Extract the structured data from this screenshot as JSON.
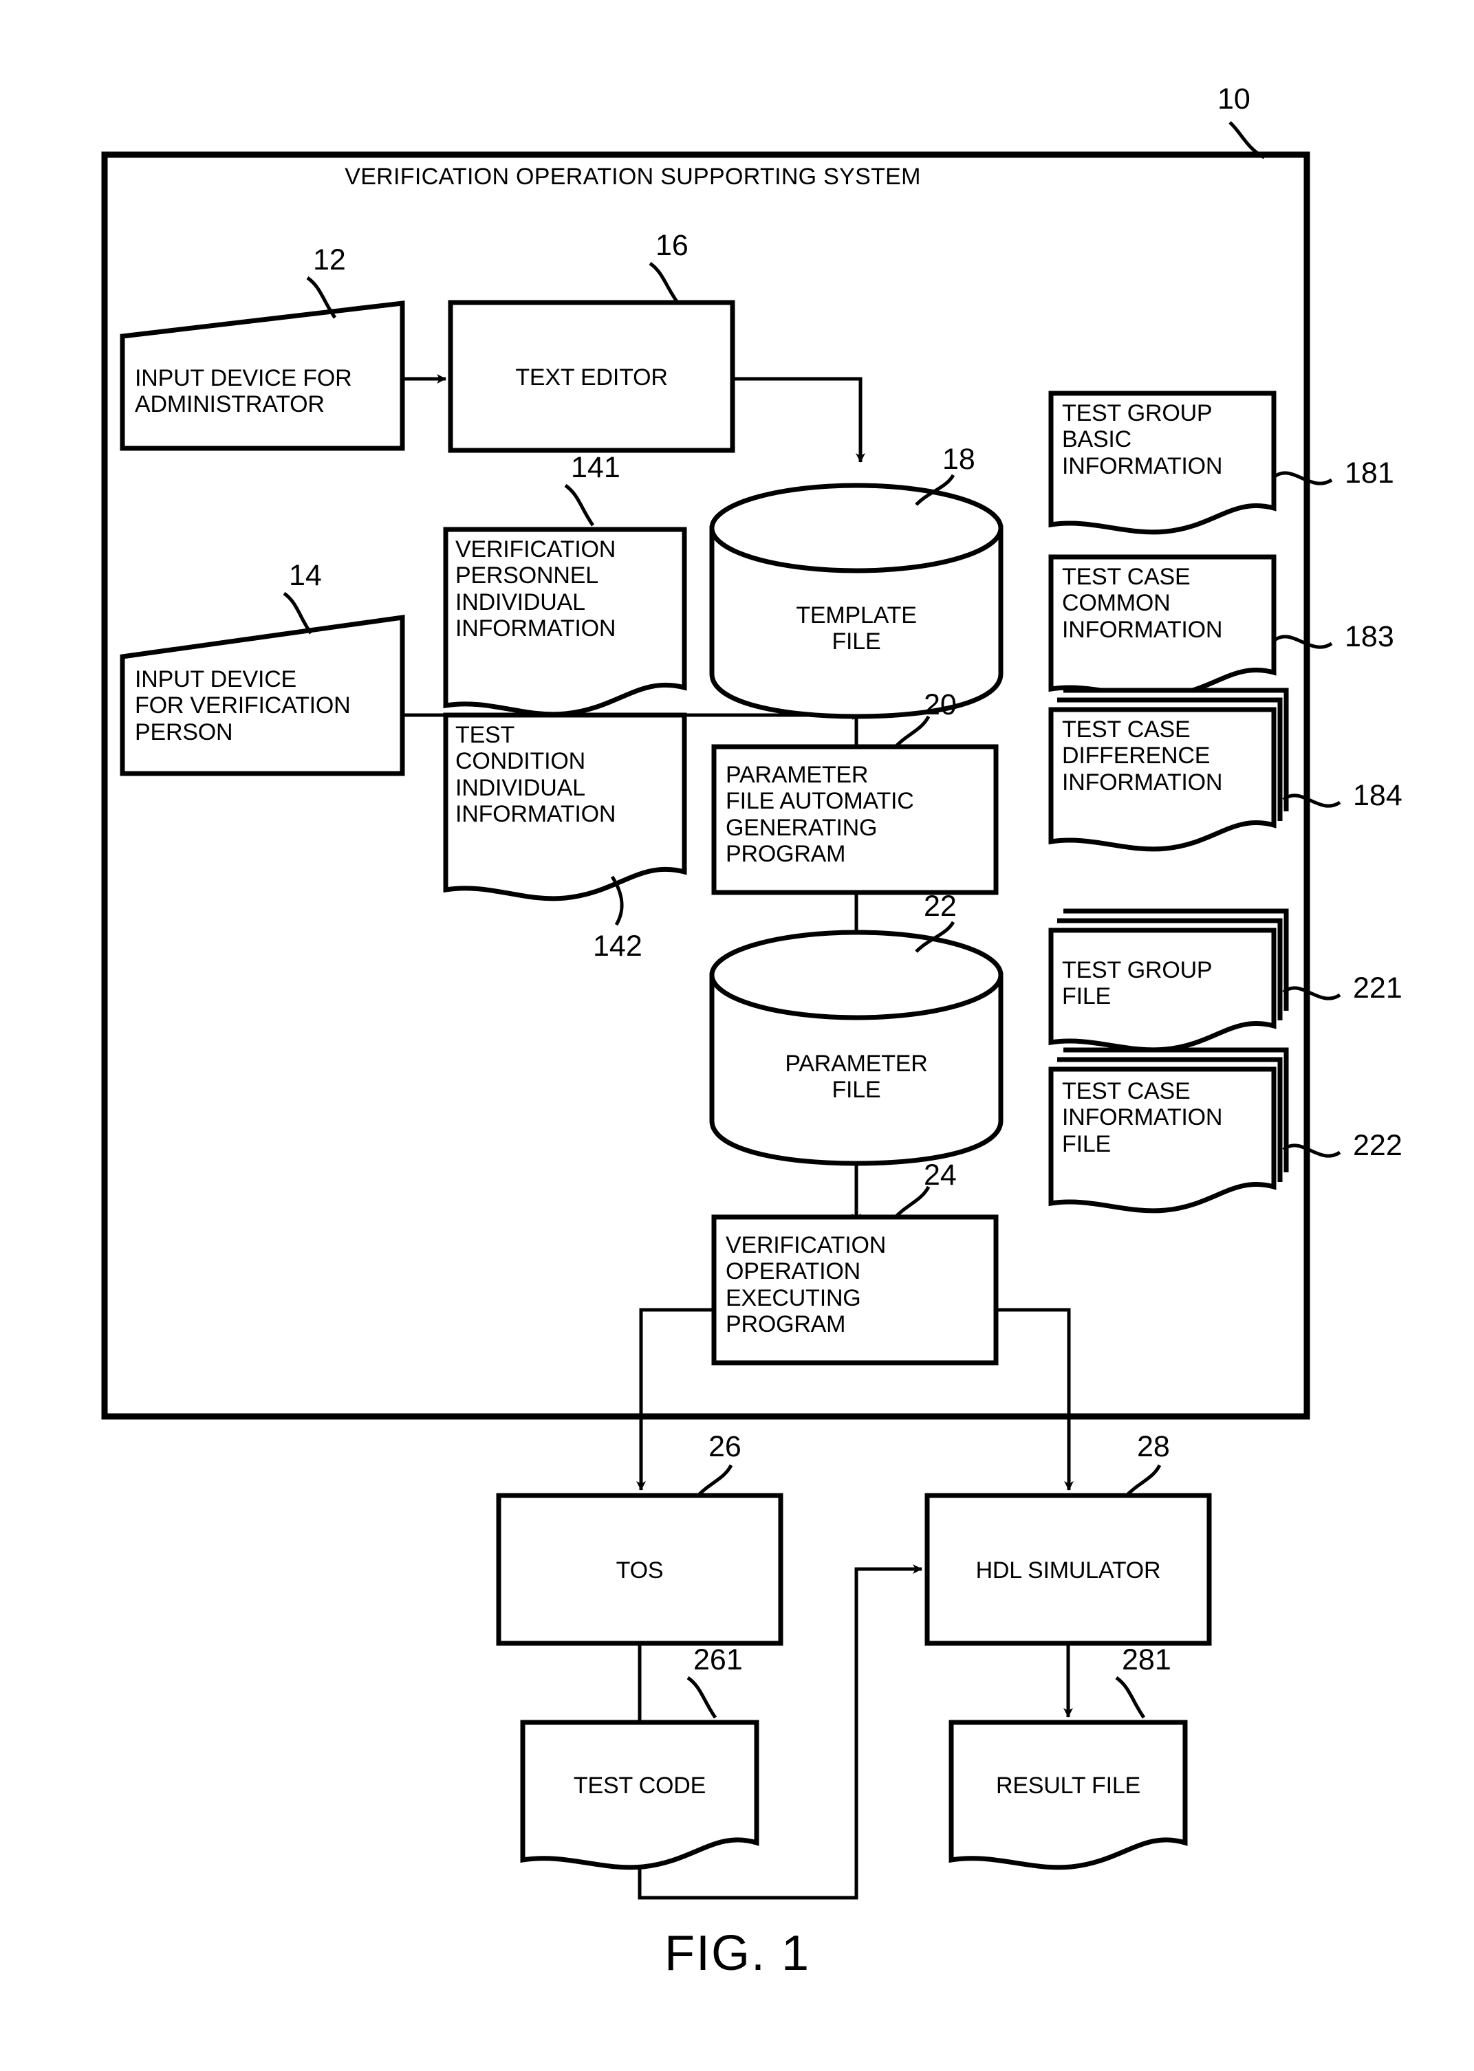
{
  "figure": {
    "caption": "FIG. 1",
    "system_title": "VERIFICATION OPERATION SUPPORTING SYSTEM",
    "system_ref": "10"
  },
  "nodes": {
    "input_device_admin": {
      "label": "INPUT DEVICE FOR\nADMINISTRATOR",
      "ref": "12",
      "shape": "trapezoid"
    },
    "text_editor": {
      "label": "TEXT EDITOR",
      "ref": "16",
      "shape": "rect"
    },
    "input_device_verifier": {
      "label": "INPUT DEVICE\nFOR VERIFICATION\nPERSON",
      "ref": "14",
      "shape": "trapezoid"
    },
    "verification_personnel_individual_information": {
      "label": "VERIFICATION\nPERSONNEL\nINDIVIDUAL\nINFORMATION",
      "ref": "141",
      "shape": "document"
    },
    "test_condition_individual_information": {
      "label": "TEST\nCONDITION\nINDIVIDUAL\nINFORMATION",
      "ref": "142",
      "shape": "document"
    },
    "template_file": {
      "label": "TEMPLATE\nFILE",
      "ref": "18",
      "shape": "cylinder"
    },
    "parameter_file_generating_program": {
      "label": "PARAMETER\nFILE AUTOMATIC\nGENERATING\nPROGRAM",
      "ref": "20",
      "shape": "rect"
    },
    "parameter_file": {
      "label": "PARAMETER\nFILE",
      "ref": "22",
      "shape": "cylinder"
    },
    "verification_operation_executing_program": {
      "label": "VERIFICATION\nOPERATION\nEXECUTING\nPROGRAM",
      "ref": "24",
      "shape": "rect"
    },
    "test_group_basic_information": {
      "label": "TEST GROUP\nBASIC\nINFORMATION",
      "ref": "181",
      "shape": "document"
    },
    "test_case_common_information": {
      "label": "TEST CASE\nCOMMON\nINFORMATION",
      "ref": "183",
      "shape": "document"
    },
    "test_case_difference_information": {
      "label": "TEST CASE\nDIFFERENCE\nINFORMATION",
      "ref": "184",
      "shape": "document-stack"
    },
    "test_group_file": {
      "label": "TEST GROUP\nFILE",
      "ref": "221",
      "shape": "document-stack"
    },
    "test_case_information_file": {
      "label": "TEST CASE\nINFORMATION\nFILE",
      "ref": "222",
      "shape": "document-stack"
    },
    "tos": {
      "label": "TOS",
      "ref": "26",
      "shape": "rect"
    },
    "hdl_simulator": {
      "label": "HDL SIMULATOR",
      "ref": "28",
      "shape": "rect"
    },
    "test_code": {
      "label": "TEST CODE",
      "ref": "261",
      "shape": "document"
    },
    "result_file": {
      "label": "RESULT FILE",
      "ref": "281",
      "shape": "document"
    }
  },
  "colors": {
    "stroke": "#000000",
    "background": "#ffffff"
  }
}
